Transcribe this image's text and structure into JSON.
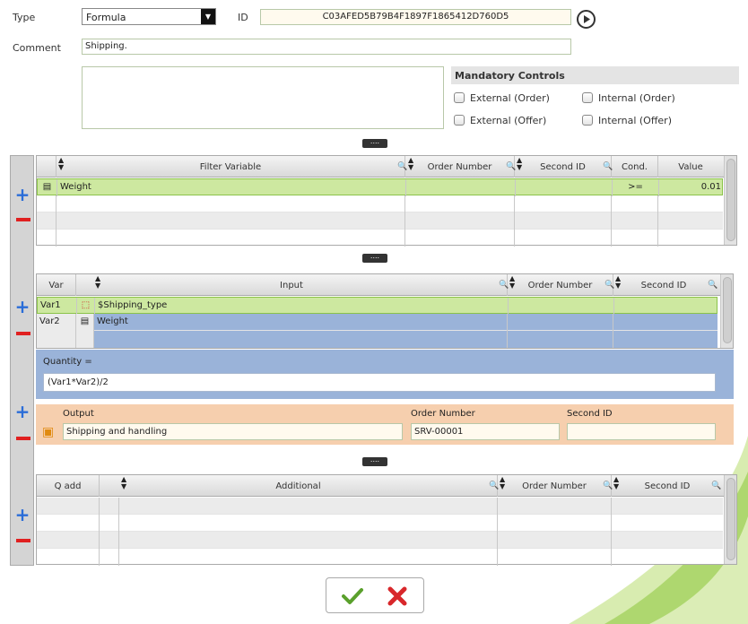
{
  "form": {
    "type_label": "Type",
    "type_value": "Formula",
    "id_label": "ID",
    "id_value": "C03AFED5B79B4F1897F1865412D760D5",
    "comment_label": "Comment",
    "comment_value": "Shipping."
  },
  "mandatory": {
    "title": "Mandatory Controls",
    "external_order": "External (Order)",
    "internal_order": "Internal (Order)",
    "external_offer": "External (Offer)",
    "internal_offer": "Internal (Offer)"
  },
  "splitter_label": "....",
  "filter_grid": {
    "headers": {
      "filter_variable": "Filter Variable",
      "order_number": "Order Number",
      "second_id": "Second ID",
      "cond": "Cond.",
      "value": "Value"
    },
    "rows": [
      {
        "variable": "Weight",
        "order_number": "",
        "second_id": "",
        "cond": ">=",
        "value": "0.01"
      }
    ]
  },
  "var_grid": {
    "headers": {
      "var": "Var",
      "input": "Input",
      "order_number": "Order Number",
      "second_id": "Second ID"
    },
    "rows": [
      {
        "var": "Var1",
        "input": "$Shipping_type"
      },
      {
        "var": "Var2",
        "input": "Weight"
      }
    ]
  },
  "quantity": {
    "label": "Quantity =",
    "formula": "(Var1*Var2)/2"
  },
  "output": {
    "output_label": "Output",
    "output_value": "Shipping and handling",
    "order_number_label": "Order Number",
    "order_number_value": "SRV-00001",
    "second_id_label": "Second ID",
    "second_id_value": ""
  },
  "additional_grid": {
    "headers": {
      "q_add": "Q add",
      "additional": "Additional",
      "order_number": "Order Number",
      "second_id": "Second ID"
    }
  },
  "colors": {
    "accent_green": "#8bc34a",
    "selected_blue": "#9ab3d9",
    "output_bg": "#f6cfae",
    "plus_blue": "#2a6dd8",
    "minus_red": "#e02020"
  }
}
